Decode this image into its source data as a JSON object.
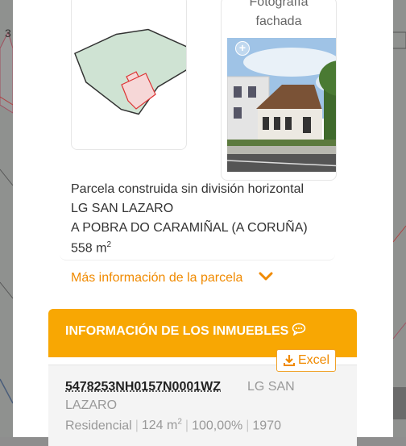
{
  "parcel": {
    "photo_title_line1": "Fotografía",
    "photo_title_line2": "fachada",
    "type": "Parcela construida sin división horizontal",
    "address": "LG SAN LAZARO",
    "municipality": "A POBRA DO CARAMIÑAL (A CORUÑA)",
    "area_value": "558 m",
    "area_sup": "2"
  },
  "more_info_label": "Más información de la parcela",
  "buildings": {
    "title": "INFORMACIÓN DE LOS INMUEBLES",
    "excel_label": "Excel",
    "accent_color": "#f8a703"
  },
  "property": {
    "reference": "5478253NH0157N0001WZ",
    "location_part1": "LG SAN",
    "location_part2": "LAZARO",
    "use": "Residencial",
    "area": "124 m",
    "area_sup": "2",
    "share": "100,00%",
    "year": "1970"
  },
  "map_labels": {
    "left_number": "3"
  },
  "icons": [
    "zoom-in-icon",
    "chevron-down-icon",
    "chat-bubble-icon",
    "download-icon"
  ]
}
